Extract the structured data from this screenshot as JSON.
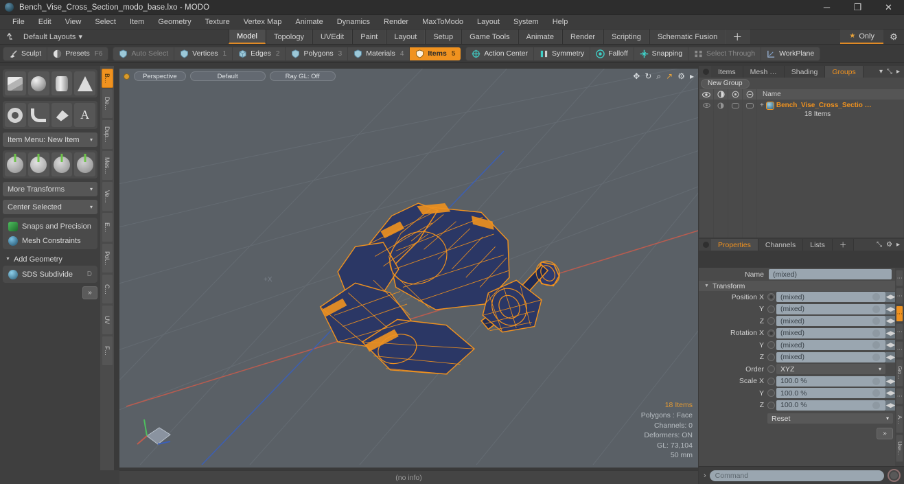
{
  "window": {
    "title": "Bench_Vise_Cross_Section_modo_base.lxo - MODO",
    "app_icon": "modo-sphere-icon",
    "minimize": "─",
    "maximize": "❐",
    "close": "✕"
  },
  "menubar": {
    "items": [
      "File",
      "Edit",
      "View",
      "Select",
      "Item",
      "Geometry",
      "Texture",
      "Vertex Map",
      "Animate",
      "Dynamics",
      "Render",
      "MaxToModo",
      "Layout",
      "System",
      "Help"
    ]
  },
  "layoutbar": {
    "anchor_icon": "anchor-icon",
    "layouts_label": "Default Layouts",
    "layouts_caret": "▾",
    "tabs": [
      {
        "label": "Model",
        "active": true
      },
      {
        "label": "Topology",
        "active": false
      },
      {
        "label": "UVEdit",
        "active": false
      },
      {
        "label": "Paint",
        "active": false
      },
      {
        "label": "Layout",
        "active": false
      },
      {
        "label": "Setup",
        "active": false
      },
      {
        "label": "Game Tools",
        "active": false
      },
      {
        "label": "Animate",
        "active": false
      },
      {
        "label": "Render",
        "active": false
      },
      {
        "label": "Scripting",
        "active": false
      },
      {
        "label": "Schematic Fusion",
        "active": false
      }
    ],
    "plus": "＋",
    "only_star": "★",
    "only_label": "Only",
    "gear": "⚙"
  },
  "modebar": {
    "group1": [
      {
        "label": "Sculpt",
        "icon": "brush-icon",
        "state": "normal",
        "num": ""
      },
      {
        "label": "Presets",
        "icon": "sphere-half-icon",
        "state": "normal",
        "num": "F6"
      }
    ],
    "group2": [
      {
        "label": "Auto Select",
        "icon": "shield-icon",
        "state": "dim",
        "num": ""
      },
      {
        "label": "Vertices",
        "icon": "shield-icon",
        "state": "normal",
        "num": "1"
      },
      {
        "label": "Edges",
        "icon": "cube-icon",
        "state": "normal",
        "num": "2"
      },
      {
        "label": "Polygons",
        "icon": "shield-icon",
        "state": "normal",
        "num": "3"
      },
      {
        "label": "Materials",
        "icon": "shield-icon",
        "state": "normal",
        "num": "4"
      },
      {
        "label": "Items",
        "icon": "shield-icon",
        "state": "active",
        "num": "5"
      }
    ],
    "group3": [
      {
        "label": "Action Center",
        "icon": "crosshair-icon",
        "state": "normal",
        "num": ""
      },
      {
        "label": "Symmetry",
        "icon": "mirror-icon",
        "state": "normal",
        "num": ""
      },
      {
        "label": "Falloff",
        "icon": "target-icon",
        "state": "normal",
        "num": ""
      },
      {
        "label": "Snapping",
        "icon": "snap-icon",
        "state": "normal",
        "num": ""
      },
      {
        "label": "Select Through",
        "icon": "select-through-icon",
        "state": "dim",
        "num": ""
      },
      {
        "label": "WorkPlane",
        "icon": "workplane-icon",
        "state": "normal",
        "num": ""
      }
    ]
  },
  "toolbox": {
    "primitives_row1": [
      {
        "name": "cube-tool",
        "shape": "box"
      },
      {
        "name": "sphere-tool",
        "shape": "sphere"
      },
      {
        "name": "cylinder-tool",
        "shape": "cyl"
      },
      {
        "name": "cone-tool",
        "shape": "cone"
      }
    ],
    "primitives_row2": [
      {
        "name": "torus-tool",
        "shape": "torus"
      },
      {
        "name": "curve-tool",
        "shape": "curve"
      },
      {
        "name": "polygon-tool",
        "shape": "poly"
      },
      {
        "name": "text-tool",
        "shape": "text"
      }
    ],
    "item_menu": "Item Menu: New Item",
    "transforms": [
      {
        "name": "move-tool"
      },
      {
        "name": "rotate-tool"
      },
      {
        "name": "scale-tool"
      },
      {
        "name": "transform-tool"
      }
    ],
    "more_transforms": "More Transforms",
    "center_selected": "Center Selected",
    "snaps_precision": "Snaps and Precision",
    "mesh_constraints": "Mesh Constraints",
    "add_geometry": "Add Geometry",
    "sds_subdivide": "SDS Subdivide",
    "sds_key": "D",
    "more_button": "»",
    "caret": "▾",
    "tri": "▼",
    "vtabs": [
      {
        "label": "B…",
        "active": true
      },
      {
        "label": "De…",
        "active": false
      },
      {
        "label": "Dup…",
        "active": false
      },
      {
        "label": "Mes…",
        "active": false
      },
      {
        "label": "Ve…",
        "active": false
      },
      {
        "label": "E…",
        "active": false
      },
      {
        "label": "Pol…",
        "active": false
      },
      {
        "label": "C…",
        "active": false
      },
      {
        "label": "UV",
        "active": false
      },
      {
        "label": "F…",
        "active": false
      }
    ]
  },
  "viewport": {
    "dot": "viewport-indicator",
    "pills": [
      "Perspective",
      "Default",
      "Ray GL: Off"
    ],
    "tools": [
      {
        "name": "pan-icon",
        "glyph": "✥",
        "highlight": false
      },
      {
        "name": "rotate-icon",
        "glyph": "↻",
        "highlight": false
      },
      {
        "name": "zoom-icon",
        "glyph": "⌕",
        "highlight": false
      },
      {
        "name": "fit-icon",
        "glyph": "↗",
        "highlight": true
      },
      {
        "name": "gear-icon",
        "glyph": "⚙",
        "highlight": false
      },
      {
        "name": "chevron-right-icon",
        "glyph": "▸",
        "highlight": false
      }
    ],
    "axis_label": "+X",
    "info": [
      "18 Items",
      "Polygons : Face",
      "Channels: 0",
      "Deformers: ON",
      "GL: 73,104",
      "50 mm"
    ],
    "model_name": "bench-vise-wireframe",
    "wire_color": "#f0921f",
    "face_color": "#2e3a6e",
    "bg_color": "#5a6066"
  },
  "groups_panel": {
    "tabs": [
      {
        "label": "Items",
        "active": false
      },
      {
        "label": "Mesh …",
        "active": false
      },
      {
        "label": "Shading",
        "active": false
      },
      {
        "label": "Groups",
        "active": true
      }
    ],
    "tab_caret": "▾",
    "expand_icon": "⤡",
    "more_icon": "▸",
    "new_group": "New Group",
    "col_icons": [
      "eye-icon",
      "render-icon",
      "shade-icon",
      "lock-icon"
    ],
    "name_header": "Name",
    "row": {
      "name": "Bench_Vise_Cross_Sectio …",
      "count": "18 Items",
      "expander": "+",
      "item_icon": "group-icon"
    }
  },
  "properties_panel": {
    "tabs": [
      {
        "label": "Properties",
        "active": true
      },
      {
        "label": "Channels",
        "active": false
      },
      {
        "label": "Lists",
        "active": false
      }
    ],
    "plus": "＋",
    "expand_icon": "⤡",
    "gear_icon": "⚙",
    "more_icon": "▸",
    "name_label": "Name",
    "name_value": "(mixed)",
    "transform_section": "Transform",
    "section_tri": "▼",
    "rows": [
      {
        "label": "Position X",
        "value": "(mixed)",
        "type": "field"
      },
      {
        "label": "Y",
        "value": "(mixed)",
        "type": "field"
      },
      {
        "label": "Z",
        "value": "(mixed)",
        "type": "field"
      },
      {
        "label": "Rotation X",
        "value": "(mixed)",
        "type": "field"
      },
      {
        "label": "Y",
        "value": "(mixed)",
        "type": "field"
      },
      {
        "label": "Z",
        "value": "(mixed)",
        "type": "field"
      },
      {
        "label": "Order",
        "value": "XYZ",
        "type": "select"
      },
      {
        "label": "Scale X",
        "value": "100.0 %",
        "type": "field"
      },
      {
        "label": "Y",
        "value": "100.0 %",
        "type": "field"
      },
      {
        "label": "Z",
        "value": "100.0 %",
        "type": "field"
      }
    ],
    "reset_label": "Reset",
    "reset_caret": "▾",
    "more_button": "»",
    "nudge_glyph": "◀▶",
    "vtabs": [
      {
        "label": "⋮",
        "active": false
      },
      {
        "label": "⋮",
        "active": false
      },
      {
        "label": "⋮",
        "active": true
      },
      {
        "label": "⋮",
        "active": false
      },
      {
        "label": "⋮",
        "active": false
      },
      {
        "label": "Gro…",
        "active": false
      },
      {
        "label": "⋮",
        "active": false
      },
      {
        "label": "A…",
        "active": false
      },
      {
        "label": "Use…",
        "active": false
      }
    ]
  },
  "statusbar": {
    "text": "(no info)"
  },
  "commandbar": {
    "caret": "›",
    "placeholder": "Command",
    "record_button": "record-icon"
  }
}
